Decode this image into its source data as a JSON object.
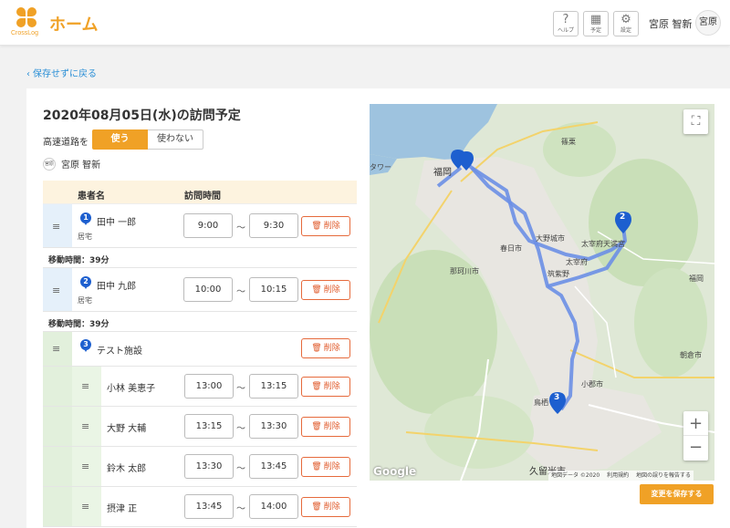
{
  "app": {
    "logo_text": "CrossLog",
    "title": "ホーム"
  },
  "header": {
    "buttons": [
      {
        "icon": "?",
        "label": "ヘルプ"
      },
      {
        "icon": "▦",
        "label": "予定"
      },
      {
        "icon": "⚙",
        "label": "設定"
      }
    ],
    "user_name": "宮原 智新",
    "avatar_text": "宮原"
  },
  "back_link": "保存せずに戻る",
  "visit": {
    "title": "2020年08月05日(水)の訪問予定",
    "highway_label": "高速道路を",
    "highway_on": "使う",
    "highway_off": "使わない",
    "staff_avatar": "宮原",
    "staff_name": "宮原 智新"
  },
  "table": {
    "col_patient": "患者名",
    "col_time": "訪問時間",
    "delete_label": "削除",
    "tilde": "〜",
    "travel_1": "移動時間：39分",
    "travel_2": "移動時間：39分",
    "rows": [
      {
        "num": "1",
        "name": "田中 一郎",
        "type": "居宅",
        "start": "9:00",
        "end": "9:30"
      },
      {
        "num": "2",
        "name": "田中 九郎",
        "type": "居宅",
        "start": "10:00",
        "end": "10:15"
      }
    ],
    "facility": {
      "num": "3",
      "name": "テスト施設"
    },
    "facility_rows": [
      {
        "name": "小林 美恵子",
        "start": "13:00",
        "end": "13:15"
      },
      {
        "name": "大野 大輔",
        "start": "13:15",
        "end": "13:30"
      },
      {
        "name": "鈴木 太郎",
        "start": "13:30",
        "end": "13:45"
      },
      {
        "name": "摂津 正",
        "start": "13:45",
        "end": "14:00"
      }
    ]
  },
  "map": {
    "labels": {
      "fukuoka": "福岡",
      "kasuga": "春日市",
      "nakagawa": "那珂川市",
      "onojo": "大野城市",
      "dazaifu_ten": "太宰府天満宮",
      "dazaifu": "太宰府",
      "chikushino": "筑紫野",
      "ogori": "小郡市",
      "tosu": "鳥栖",
      "kurume": "久留米市",
      "asakura": "朝倉市",
      "fukuoka_east": "福岡",
      "kasuya": "篠栗",
      "tower": "タワー",
      "google": "Google",
      "copyright": "地図データ ©2020",
      "terms": "利用規約",
      "report": "地図の誤りを報告する"
    },
    "markers": [
      "2",
      "3"
    ],
    "zoom_in": "+",
    "zoom_out": "−",
    "fullscreen": "⛶"
  },
  "save_button": "変更を保存する",
  "colors": {
    "accent": "#f0a126",
    "danger": "#e05a2a",
    "route": "#6b8fe6",
    "pin": "#1d5fcf"
  }
}
